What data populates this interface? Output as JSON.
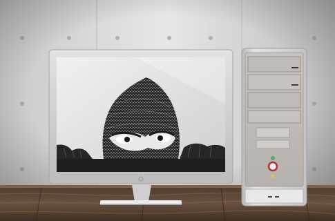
{
  "scene": {
    "subject": "monitor-and-tower-pc-with-masked-figure-on-screen",
    "colors": {
      "wall": "#d9d9d9",
      "wall_shadow": "#a8a8a8",
      "wood": "#5a4333",
      "wood_light": "#8b6d55",
      "bezel": "#d6d6d6",
      "bezel_dark": "#9e9e9e",
      "screen_bg": "#e6e6e6",
      "mask": "#2a2a2a",
      "tower_body": "#cfcfcf",
      "led_red": "#b0303a",
      "led_green": "#49b05a",
      "led_yellow": "#e0c44a"
    }
  }
}
